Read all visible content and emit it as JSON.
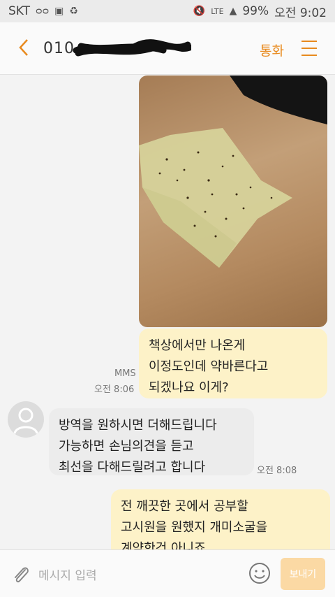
{
  "status_bar": {
    "carrier": "SKT",
    "battery": "99%",
    "time": "오전 9:02",
    "network": "LTE"
  },
  "header": {
    "contact": "010-",
    "call_label": "통화"
  },
  "messages": [
    {
      "id": "m1",
      "direction": "outgoing",
      "lines": [
        "책상에서만 나온게",
        "이정도인데 약바른다고",
        "되겠나요 이게?"
      ],
      "type_label": "MMS",
      "time": "오전 8:06"
    },
    {
      "id": "m2",
      "direction": "incoming",
      "lines": [
        "방역을 원하시면 더해드립니다",
        "가능하면 손님의견을 듣고",
        "최선을 다해드릴려고 합니다"
      ],
      "time": "오전 8:08"
    },
    {
      "id": "m3",
      "direction": "outgoing",
      "lines": [
        "전 깨끗한 곳에서 공부할",
        "고시원을 원했지 개미소굴을",
        "계약한건 아니죠"
      ]
    }
  ],
  "input": {
    "placeholder": "메시지 입력",
    "send_label": "보내기"
  },
  "colors": {
    "accent": "#e88a1e",
    "outgoing_bubble": "#fdf2c8",
    "incoming_bubble": "#ececec",
    "send_button": "#fbd9a4"
  }
}
